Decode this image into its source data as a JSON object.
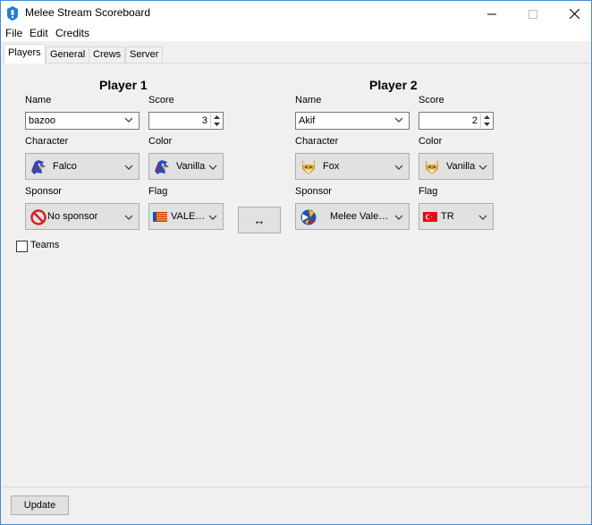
{
  "window": {
    "title": "Melee Stream Scoreboard",
    "minimize": "—",
    "maximize": "☐",
    "close": "✕"
  },
  "menu": [
    "File",
    "Edit",
    "Credits"
  ],
  "tabs": [
    "Players",
    "General",
    "Crews",
    "Server"
  ],
  "player1": {
    "title": "Player 1",
    "name_label": "Name",
    "name": "bazoo",
    "score_label": "Score",
    "score": "3",
    "character_label": "Character",
    "character": "Falco",
    "color_label": "Color",
    "color": "Vanilla",
    "sponsor_label": "Sponsor",
    "sponsor": "No sponsor",
    "flag_label": "Flag",
    "flag": "VALE…"
  },
  "player2": {
    "title": "Player 2",
    "name_label": "Name",
    "name": "Akif",
    "score_label": "Score",
    "score": "2",
    "character_label": "Character",
    "character": "Fox",
    "color_label": "Color",
    "color": "Vanilla",
    "sponsor_label": "Sponsor",
    "sponsor": "Melee Vale…",
    "flag_label": "Flag",
    "flag": "TR"
  },
  "swap_button": "↔",
  "teams_label": "Teams",
  "update_button": "Update",
  "colors": {
    "window_border": "#4a8bd6",
    "app_icon": "#1e7fd8",
    "button_face": "#e1e1e1",
    "panel": "#f0f0f0"
  }
}
